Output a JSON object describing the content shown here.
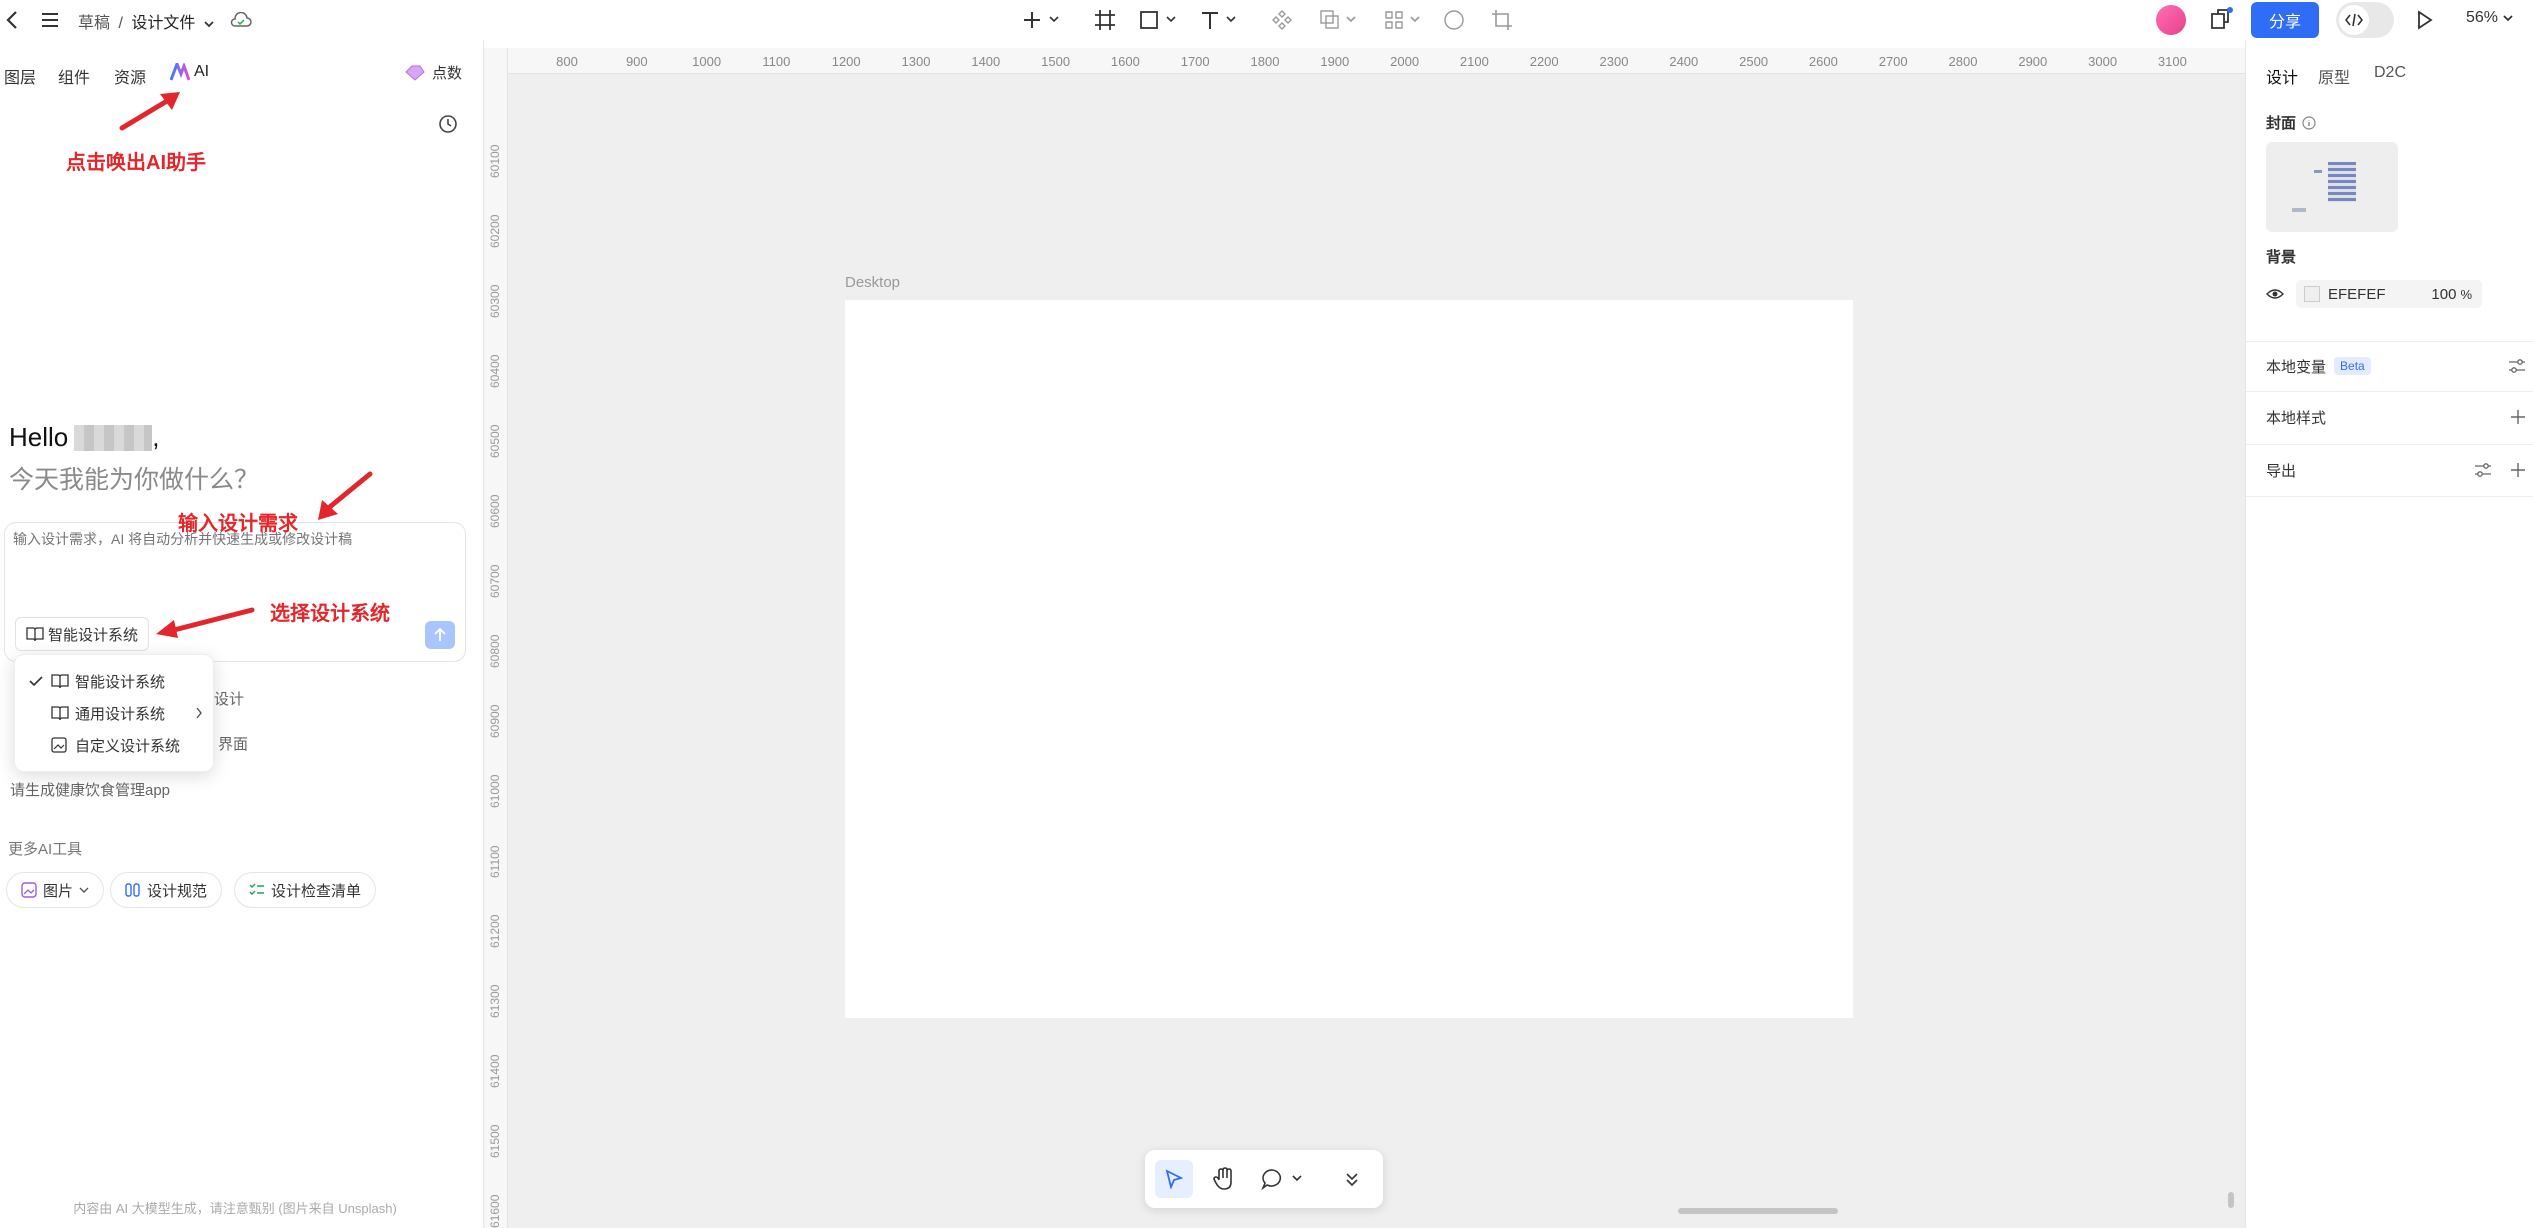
{
  "topbar": {
    "breadcrumb_root": "草稿",
    "breadcrumb_sep": "/",
    "breadcrumb_file": "设计文件",
    "share_label": "分享",
    "zoom_label": "56%"
  },
  "left_panel": {
    "tabs": [
      "图层",
      "组件",
      "资源",
      "AI"
    ],
    "points_label": "点数",
    "greeting": "Hello",
    "greeting_comma": ",",
    "subtitle": "今天我能为你做什么？",
    "input_placeholder": "输入设计需求，AI 将自动分析并快速生成或修改设计稿",
    "design_system_button": "智能设计系统",
    "dropdown": [
      {
        "label": "智能设计系统",
        "checked": true,
        "icon": "book-ai-icon"
      },
      {
        "label": "通用设计系统",
        "checked": false,
        "icon": "book-icon",
        "has_submenu": true
      },
      {
        "label": "自定义设计系统",
        "checked": false,
        "icon": "image-edit-icon"
      }
    ],
    "suggestion_partials": [
      "设计",
      "界面"
    ],
    "suggestion_full": "请生成健康饮食管理app",
    "more_tools_label": "更多AI工具",
    "tools": [
      {
        "label": "图片",
        "icon": "image-icon",
        "dropdown": true
      },
      {
        "label": "设计规范",
        "icon": "spec-icon"
      },
      {
        "label": "设计检查清单",
        "icon": "checklist-icon"
      }
    ],
    "footer_note": "内容由 AI 大模型生成，请注意甄别 (图片来自 Unsplash)"
  },
  "annotations": {
    "ai_hint": "点击唤出AI助手",
    "input_hint": "输入设计需求",
    "system_hint": "选择设计系统"
  },
  "canvas": {
    "frame_label": "Desktop",
    "ruler_top": [
      "800",
      "900",
      "1000",
      "1100",
      "1200",
      "1300",
      "1400",
      "1500",
      "1600",
      "1700",
      "1800",
      "1900",
      "2000",
      "2100",
      "2200",
      "2300",
      "2400",
      "2500",
      "2600",
      "2700",
      "2800",
      "2900",
      "3000",
      "3100"
    ],
    "ruler_left": [
      "60100",
      "60200",
      "60300",
      "60400",
      "60500",
      "60600",
      "60700",
      "60800",
      "60900",
      "61000",
      "61100",
      "61200",
      "61300",
      "61400",
      "61500",
      "61600"
    ]
  },
  "right_panel": {
    "tabs": [
      "设计",
      "原型",
      "D2C"
    ],
    "cover_label": "封面",
    "background_label": "背景",
    "background_hex": "EFEFEF",
    "background_opacity": "100",
    "percent": "%",
    "local_vars_label": "本地变量",
    "beta_badge": "Beta",
    "local_styles_label": "本地样式",
    "export_label": "导出"
  },
  "colors": {
    "accent": "#2f6df6",
    "annotation": "#e3262b",
    "canvas_bg": "#efefef"
  }
}
